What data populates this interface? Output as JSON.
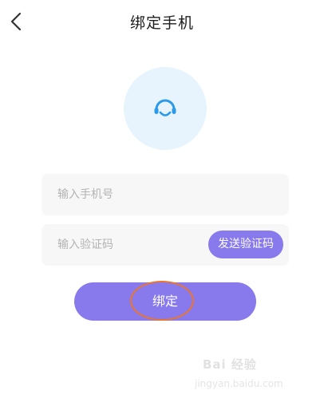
{
  "header": {
    "title": "绑定手机",
    "back_icon": "chevron-left-icon"
  },
  "avatar": {
    "icon": "customer-service-headset-icon",
    "background_color": "#e7f4fd",
    "icon_color": "#2c9ae8"
  },
  "form": {
    "phone_placeholder": "输入手机号",
    "phone_value": "",
    "code_placeholder": "输入验证码",
    "code_value": "",
    "send_code_label": "发送验证码"
  },
  "actions": {
    "bind_label": "绑定"
  },
  "watermark": {
    "logo_text": "Bai 经验",
    "url_text": "jingyan.baidu.com"
  },
  "colors": {
    "accent": "#8879ec",
    "highlight_ring": "#e9762f",
    "field_background": "#f7f7f7"
  }
}
